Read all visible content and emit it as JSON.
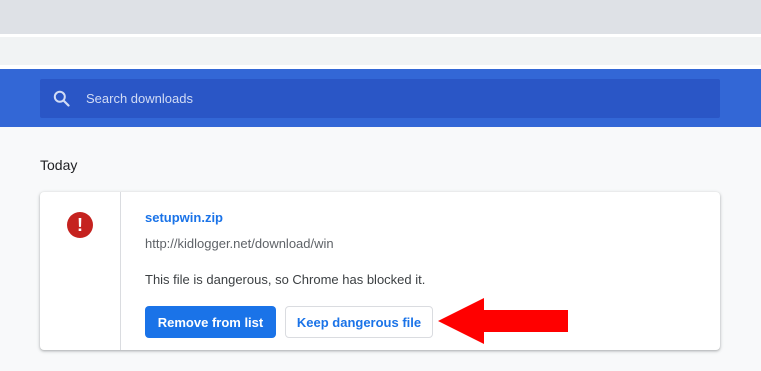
{
  "search": {
    "placeholder": "Search downloads",
    "icon": "search-icon"
  },
  "downloads": {
    "section_date": "Today",
    "item": {
      "file_name": "setupwin.zip",
      "url": "http://kidlogger.net/download/win",
      "status_text": "This file is dangerous, so Chrome has blocked it.",
      "status_icon": "danger-icon",
      "remove_button_label": "Remove from list",
      "keep_button_label": "Keep dangerous file"
    }
  },
  "colors": {
    "header_blue": "#3367d6",
    "search_blue": "#2a56c6",
    "link_blue": "#1a73e8",
    "danger_red": "#c5221f",
    "arrow_red": "#ff0000"
  }
}
